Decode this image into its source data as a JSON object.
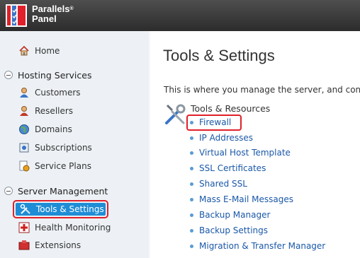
{
  "header": {
    "brand_line1": "Parallels",
    "brand_reg": "®",
    "brand_line2": "Panel"
  },
  "sidebar": {
    "home": "Home",
    "hosting_group": "Hosting Services",
    "hosting_items": [
      "Customers",
      "Resellers",
      "Domains",
      "Subscriptions",
      "Service Plans"
    ],
    "server_group": "Server Management",
    "active_item": "Tools & Settings",
    "server_items": [
      "Health Monitoring",
      "Extensions"
    ]
  },
  "main": {
    "title": "Tools & Settings",
    "description": "This is where you manage the server, and confi",
    "section_title": "Tools & Resources",
    "links": [
      "Firewall",
      "IP Addresses",
      "Virtual Host Template",
      "SSL Certificates",
      "Shared SSL",
      "Mass E-Mail Messages",
      "Backup Manager",
      "Backup Settings",
      "Migration & Transfer Manager"
    ]
  },
  "colors": {
    "accent": "#1f8dd6",
    "highlight": "#e0202a",
    "link": "#1a58a8"
  }
}
